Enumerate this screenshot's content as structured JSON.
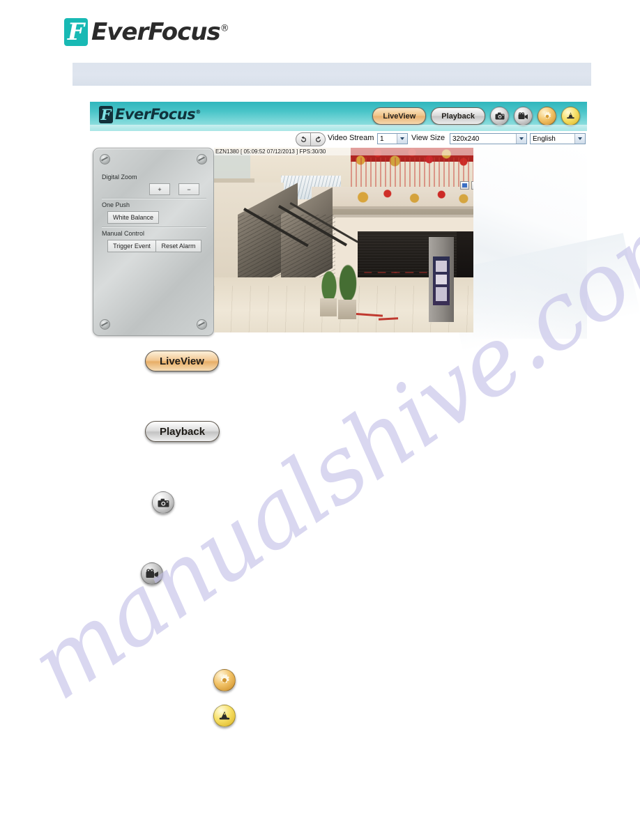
{
  "document": {
    "brand": "EverFocus",
    "brand_registered": "®",
    "section_band_text": ""
  },
  "screenshot": {
    "header": {
      "logo_text": "EverFocus",
      "logo_registered": "®",
      "buttons": [
        {
          "label": "LiveView",
          "state": "active",
          "name": "liveview-tab"
        },
        {
          "label": "Playback",
          "state": "idle",
          "name": "playback-tab"
        }
      ],
      "icon_buttons": [
        {
          "icon": "camera-snapshot-icon",
          "color": "#c9c9c9"
        },
        {
          "icon": "video-record-icon",
          "color": "#bdbdbd"
        },
        {
          "icon": "gear-setup-icon",
          "color": "#e0a53d"
        },
        {
          "icon": "wizard-hat-icon",
          "color": "#efd74a"
        }
      ]
    },
    "toolbar": {
      "rotate_left_icon": "rotate-left-icon",
      "rotate_right_icon": "rotate-right-icon",
      "video_stream_label": "Video Stream",
      "video_stream_value": "1",
      "view_size_label": "View Size",
      "view_size_value": "320x240",
      "language_value": "English"
    },
    "control_panel": {
      "sections": [
        {
          "title": "Digital Zoom",
          "buttons": [
            {
              "label": "+",
              "name": "digital-zoom-in-button"
            },
            {
              "label": "−",
              "name": "digital-zoom-out-button"
            }
          ]
        },
        {
          "title": "One Push",
          "buttons": [
            {
              "label": "White Balance",
              "name": "white-balance-button"
            }
          ]
        },
        {
          "title": "Manual Control",
          "buttons": [
            {
              "label": "Trigger Event",
              "name": "trigger-event-button"
            },
            {
              "label": "Reset Alarm",
              "name": "reset-alarm-button"
            }
          ]
        }
      ]
    },
    "video": {
      "osd_text": "EZN1380 [ 05:09:52 07/12/2013 ] FPS:30/30",
      "model": "EZN1380",
      "time": "05:09:52",
      "date": "07/12/2013",
      "fps": "FPS:30/30",
      "scene_description": "Shopping mall interior with escalators and red decorations",
      "mini_icons": [
        {
          "name": "stream-icon-blue",
          "color": "#3a6fc4"
        },
        {
          "name": "stream-icon-red",
          "color": "#c43a3a"
        },
        {
          "name": "stream-icon-green",
          "color": "#58a14a"
        },
        {
          "name": "stream-icon-yellow",
          "color": "#e0d24a"
        }
      ]
    }
  },
  "callouts": [
    {
      "type": "pill",
      "label": "LiveView",
      "state": "active",
      "name": "callout-liveview-button"
    },
    {
      "type": "pill",
      "label": "Playback",
      "state": "idle",
      "name": "callout-playback-button"
    },
    {
      "type": "circle",
      "icon": "camera-snapshot-icon",
      "style": "silver",
      "name": "callout-snapshot-button"
    },
    {
      "type": "circle",
      "icon": "video-record-icon",
      "style": "dark",
      "name": "callout-record-button"
    },
    {
      "type": "circle",
      "icon": "gear-setup-icon",
      "style": "orange",
      "name": "callout-setup-button"
    },
    {
      "type": "circle",
      "icon": "wizard-hat-icon",
      "style": "gold",
      "name": "callout-wizard-button"
    }
  ],
  "watermark": {
    "text": "manualshive.com"
  },
  "colors": {
    "brand_teal": "#18b9b4",
    "header_teal_top": "#2fb6bd",
    "header_teal_bottom": "#a9e6e6",
    "band_blue": "#dde4ee",
    "active_pill": "#f0c489",
    "watermark": "#c3c0e8"
  }
}
